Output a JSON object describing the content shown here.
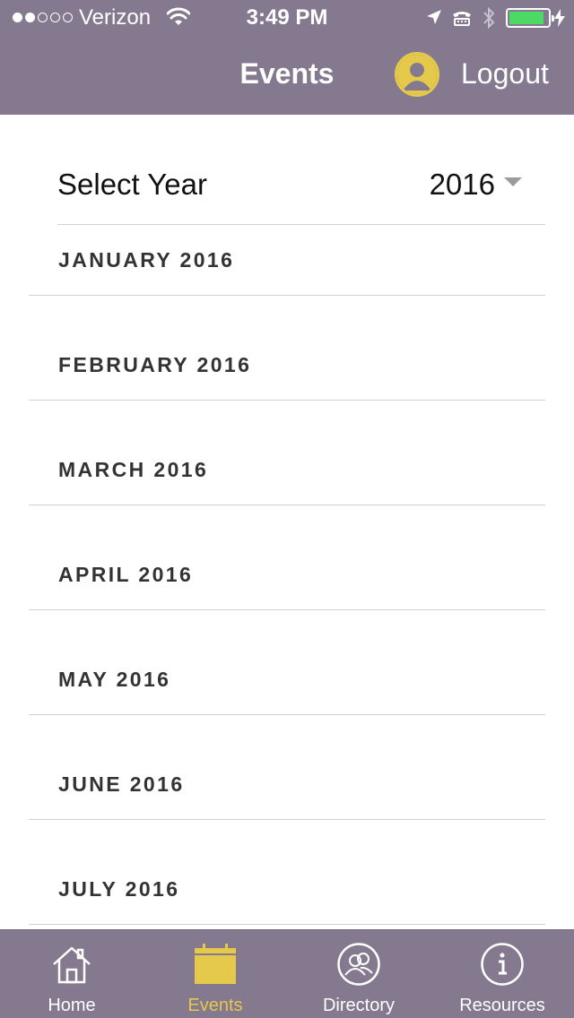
{
  "status_bar": {
    "signal_bars_filled": 2,
    "signal_bars_total": 5,
    "carrier": "Verizon",
    "time": "3:49 PM",
    "battery_level": 0.9,
    "icons": [
      "wifi-icon",
      "location-arrow-icon",
      "tty-icon",
      "bluetooth-icon",
      "battery-icon",
      "charging-bolt-icon"
    ]
  },
  "header": {
    "title": "Events",
    "logout_label": "Logout",
    "avatar_icon": "user-avatar-icon"
  },
  "year_selector": {
    "label": "Select Year",
    "value": "2016",
    "caret_icon": "dropdown-caret-icon"
  },
  "months": [
    {
      "label": "JANUARY 2016"
    },
    {
      "label": "FEBRUARY 2016"
    },
    {
      "label": "MARCH 2016"
    },
    {
      "label": "APRIL 2016"
    },
    {
      "label": "MAY 2016"
    },
    {
      "label": "JUNE 2016"
    },
    {
      "label": "JULY 2016"
    }
  ],
  "tabs": [
    {
      "label": "Home",
      "icon": "home-icon",
      "active": false
    },
    {
      "label": "Events",
      "icon": "calendar-icon",
      "active": true
    },
    {
      "label": "Directory",
      "icon": "people-icon",
      "active": false
    },
    {
      "label": "Resources",
      "icon": "info-icon",
      "active": false
    }
  ],
  "colors": {
    "bar_background": "#85798f",
    "accent_gold": "#e5c94a",
    "battery_green": "#4cd964",
    "divider": "#d0d0d0"
  }
}
